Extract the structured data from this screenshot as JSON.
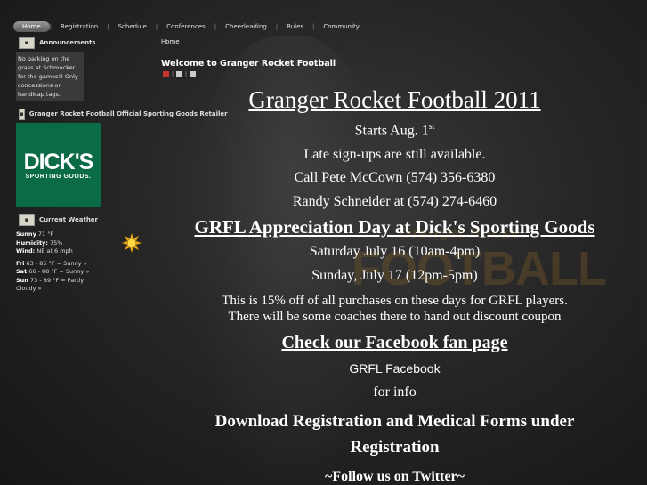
{
  "nav": {
    "items": [
      "Home",
      "Registration",
      "Schedule",
      "Conferences",
      "Cheerleading",
      "Rules",
      "Community"
    ],
    "separator": "|"
  },
  "sidebar": {
    "announcements_title": "Announcements",
    "announcement_text": "No parking on the grass at Schmucker for the games!! Only concessions or handicap tags.",
    "retailer_title": "Granger Rocket Football Official Sporting Goods Retailer",
    "dicks_logo_big": "DICK'S",
    "dicks_logo_small": "SPORTING GOODS.",
    "weather_title": "Current Weather",
    "weather": {
      "cond_label": "Sunny",
      "cond_value": "71 °F",
      "humidity_label": "Humidity:",
      "humidity_value": "75%",
      "wind_label": "Wind:",
      "wind_value": "NE at 6 mph"
    },
    "forecast": [
      {
        "day": "Fri",
        "text": "63 - 85 °F = Sunny »"
      },
      {
        "day": "Sat",
        "text": "66 - 88 °F = Sunny »"
      },
      {
        "day": "Sun",
        "text": "73 - 89 °F = Partly Cloudy »"
      }
    ]
  },
  "breadcrumb": "Home",
  "welcome_title": "Welcome to Granger Rocket Football",
  "tool_sep": "|",
  "background_logo": {
    "line1": "Granger Rocket",
    "line2": "FOOTBALL"
  },
  "content": {
    "headline": "Granger Rocket Football 2011",
    "starts": "Starts Aug. 1",
    "starts_sup": "st",
    "late": "Late sign-ups are still available.",
    "call": "Call Pete McCown (574) 356-6380",
    "randy": "Randy Schneider at (574) 274-6460",
    "appreciation": "GRFL Appreciation Day at Dick's Sporting Goods",
    "sat": "Saturday July 16 (10am-4pm)",
    "sun": "Sunday, July 17 (12pm-5pm)",
    "discount_1": "This is 15% off of all purchases on these days for GRFL players.",
    "discount_2": "There will be some coaches there to hand out discount coupon",
    "facebook_heading": "Check our Facebook fan page",
    "facebook_link": "GRFL Facebook",
    "for_info": "for info",
    "forms_1": "Download Registration and Medical Forms under",
    "forms_2": "Registration",
    "twitter": "~Follow us on Twitter~"
  }
}
